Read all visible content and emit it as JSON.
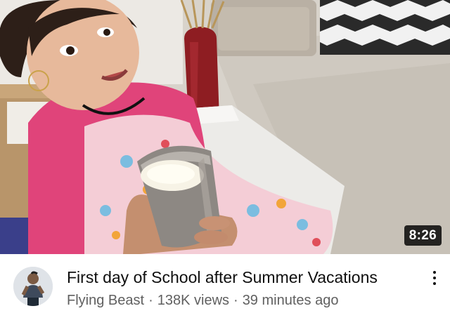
{
  "video": {
    "title": "First day of School after Summer Vacations",
    "duration": "8:26",
    "channel": "Flying Beast",
    "views": "138K views",
    "age": "39 minutes ago",
    "separator": "·"
  },
  "icons": {
    "menu": "more-vert-icon",
    "avatar": "channel-avatar"
  },
  "colors": {
    "title": "#0f0f0f",
    "secondary_text": "#606060",
    "duration_bg": "#000000",
    "duration_text": "#ffffff"
  }
}
